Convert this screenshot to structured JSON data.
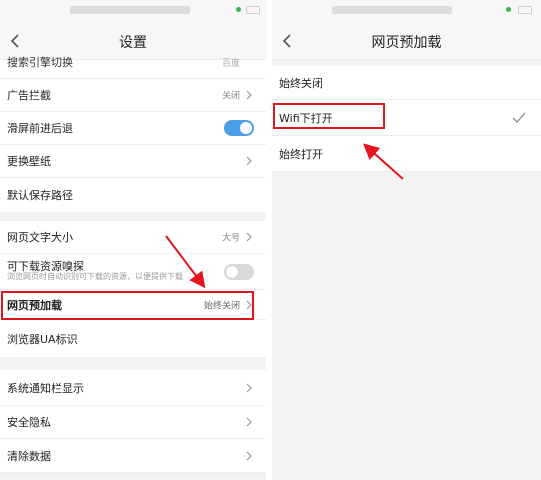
{
  "left": {
    "title": "设置",
    "rows": [
      {
        "label": "搜索引擎切换",
        "value": "百度"
      },
      {
        "label": "广告拦截",
        "value": "关闭"
      },
      {
        "label": "滑屏前进后退"
      },
      {
        "label": "更换壁纸"
      },
      {
        "label": "默认保存路径"
      },
      {
        "label": "网页文字大小",
        "value": "大号"
      },
      {
        "label": "可下载资源嗅探",
        "sublabel": "浏览网页时自动识别可下载的资源，以便提供下载"
      },
      {
        "label": "网页预加载",
        "value": "始终关闭"
      },
      {
        "label": "浏览器UA标识"
      },
      {
        "label": "系统通知栏显示"
      },
      {
        "label": "安全隐私"
      },
      {
        "label": "清除数据"
      }
    ]
  },
  "right": {
    "title": "网页预加载",
    "options": [
      {
        "label": "始终关闭"
      },
      {
        "label": "Wifi下打开"
      },
      {
        "label": "始终打开"
      }
    ]
  },
  "colors": {
    "accent": "#4a9fe8",
    "annotation_red": "#e2141e",
    "page_bg": "#f3f3f3",
    "row_bg": "#ffffff"
  },
  "icons": {
    "back": "chevron-left-icon",
    "row_arrow": "chevron-right-icon",
    "selected": "check-icon",
    "pointer": "red-arrow"
  }
}
